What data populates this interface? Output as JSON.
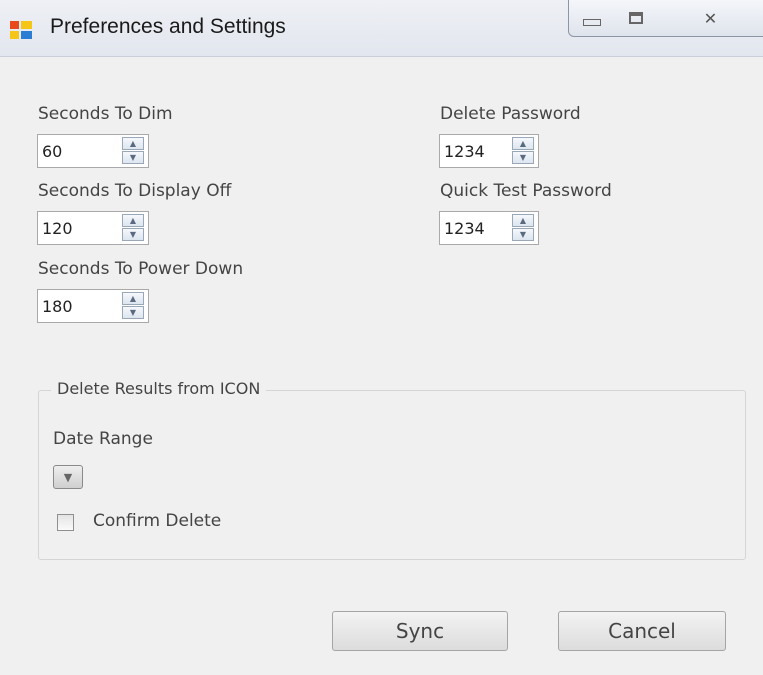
{
  "window": {
    "title": "Preferences and Settings",
    "buttons": {
      "minimize_icon": "minimize-icon",
      "maximize_icon": "restore-icon",
      "close_icon": "close-icon"
    }
  },
  "fields": {
    "seconds_to_dim": {
      "label": "Seconds To Dim",
      "value": "60"
    },
    "seconds_to_display_off": {
      "label": "Seconds To Display Off",
      "value": "120"
    },
    "seconds_to_power_down": {
      "label": "Seconds To Power Down",
      "value": "180"
    },
    "delete_password": {
      "label": "Delete Password",
      "value": "1234"
    },
    "quick_test_password": {
      "label": "Quick Test Password",
      "value": "1234"
    }
  },
  "delete_group": {
    "title": "Delete Results from ICON",
    "date_range_label": "Date Range",
    "date_range_value": "",
    "confirm_label": "Confirm Delete",
    "confirm_checked": false
  },
  "actions": {
    "sync": "Sync",
    "cancel": "Cancel"
  },
  "glyphs": {
    "up": "▲",
    "down": "▼",
    "dropdown": "▼",
    "close": "✕"
  }
}
